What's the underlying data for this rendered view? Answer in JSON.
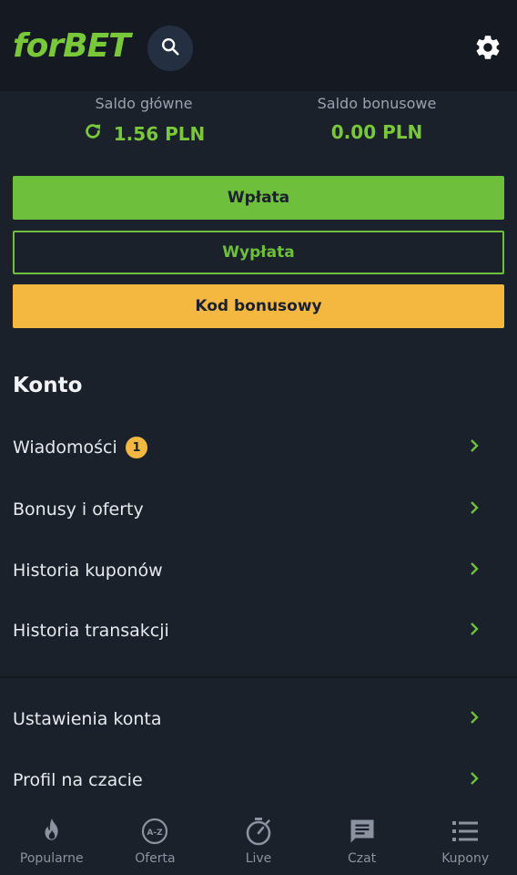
{
  "header": {
    "logo": "forBET"
  },
  "balances": {
    "main_label": "Saldo główne",
    "main_value": "1.56 PLN",
    "bonus_label": "Saldo bonusowe",
    "bonus_value": "0.00 PLN"
  },
  "buttons": {
    "deposit": "Wpłata",
    "withdraw": "Wypłata",
    "bonus_code": "Kod bonusowy"
  },
  "account": {
    "title": "Konto",
    "items": [
      {
        "label": "Wiadomości",
        "badge": "1"
      },
      {
        "label": "Bonusy i oferty"
      },
      {
        "label": "Historia kuponów"
      },
      {
        "label": "Historia transakcji"
      },
      {
        "label": "Ustawienia konta"
      },
      {
        "label": "Profil na czacie"
      }
    ]
  },
  "nav": [
    {
      "label": "Popularne",
      "icon": "flame-icon"
    },
    {
      "label": "Oferta",
      "icon": "az-icon"
    },
    {
      "label": "Live",
      "icon": "stopwatch-icon"
    },
    {
      "label": "Czat",
      "icon": "chat-icon"
    },
    {
      "label": "Kupony",
      "icon": "list-icon"
    }
  ],
  "colors": {
    "accent_green": "#6ebf3b",
    "accent_yellow": "#f4b73f",
    "background": "#1b212b"
  }
}
